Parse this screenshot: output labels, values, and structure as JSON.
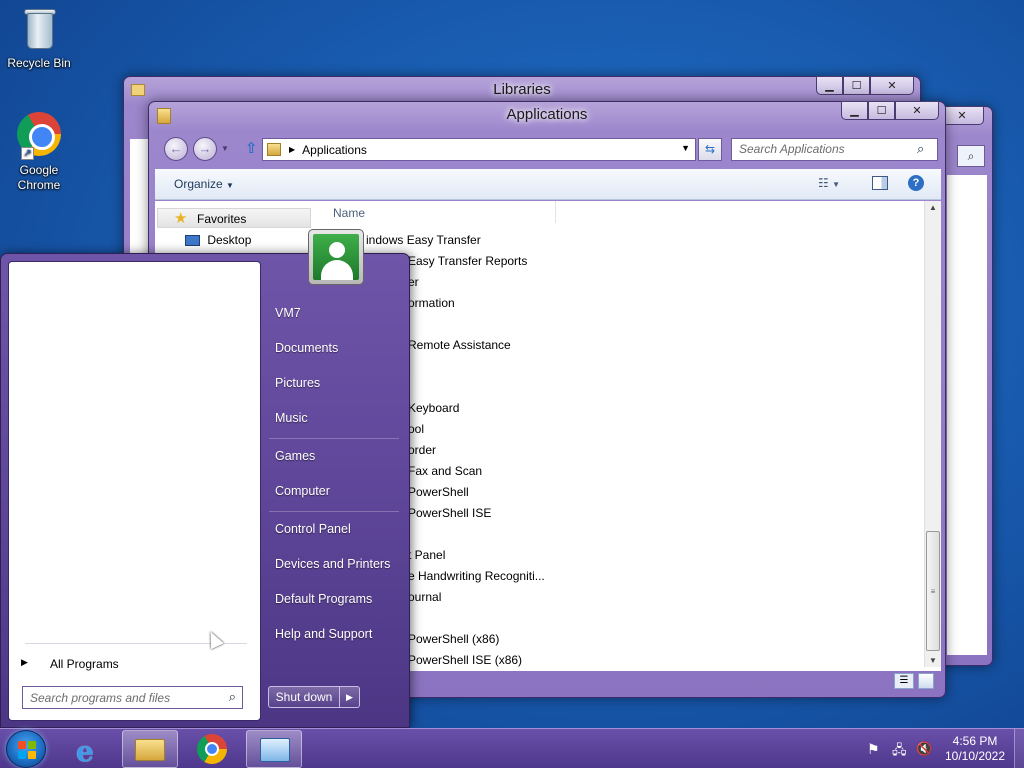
{
  "desktop": {
    "icons": [
      {
        "label": "Recycle Bin"
      },
      {
        "label": "Google\nChrome"
      }
    ]
  },
  "libraries_window": {
    "title": "Libraries"
  },
  "apps_window": {
    "title": "Applications",
    "breadcrumb": "Applications",
    "search_placeholder": "Search Applications",
    "toolbar": {
      "organize": "Organize"
    },
    "nav_pane": {
      "favorites": "Favorites",
      "desktop": "Desktop"
    },
    "column_header": "Name",
    "files": [
      "indows Easy Transfer",
      "Easy Transfer Reports",
      "er",
      "ormation",
      "Remote Assistance",
      "Keyboard",
      "ool",
      "order",
      "Fax and Scan",
      "PowerShell",
      "PowerShell ISE",
      "t Panel",
      "e Handwriting Recogniti...",
      "ournal",
      "PowerShell (x86)",
      "PowerShell ISE (x86)"
    ]
  },
  "start_menu": {
    "all_programs": "All Programs",
    "search_placeholder": "Search programs and files",
    "right_items": {
      "vm7": "VM7",
      "documents": "Documents",
      "pictures": "Pictures",
      "music": "Music",
      "games": "Games",
      "computer": "Computer",
      "control_panel": "Control Panel",
      "devices_printers": "Devices and Printers",
      "default_programs": "Default Programs",
      "help_support": "Help and Support"
    },
    "shutdown": "Shut down"
  },
  "taskbar": {
    "time": "4:56 PM",
    "date": "10/10/2022"
  }
}
